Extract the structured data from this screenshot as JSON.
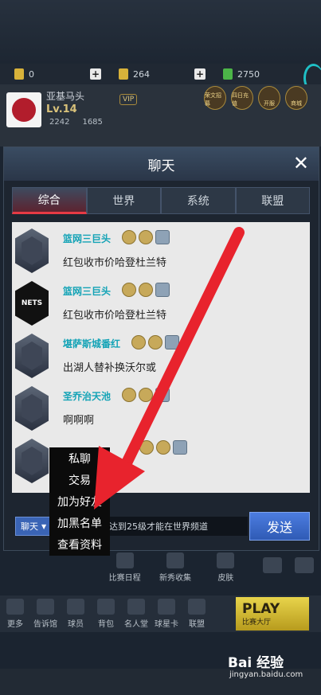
{
  "resources": [
    {
      "icon": "coin-icon",
      "value": "0"
    },
    {
      "icon": "gold-icon",
      "value": "264"
    },
    {
      "icon": "cash-icon",
      "value": "2750"
    }
  ],
  "profile": {
    "name": "亚基马头",
    "level": "Lv.14",
    "vip": "VIP",
    "stat1": "2242",
    "stat2": "1685"
  },
  "top_icons": [
    "荣文招募",
    "四日充值",
    "开服",
    "商城"
  ],
  "chat": {
    "title": "聊天",
    "close": "✕",
    "tabs": [
      "综合",
      "世界",
      "系统",
      "联盟"
    ],
    "active_tab": "综合",
    "messages": [
      {
        "user": "篮网三巨头",
        "text": "红包收市价哈登杜兰特",
        "badge": "shield"
      },
      {
        "user": "篮网三巨头",
        "text": "红包收市价哈登杜兰特",
        "badge": "NETS"
      },
      {
        "user": "堪萨斯城番红",
        "text": "出湖人替补换沃尔或",
        "badge": "shield"
      },
      {
        "user": "圣乔治天池",
        "text": "啊啊啊",
        "badge": "shield"
      },
      {
        "user": "",
        "text": "",
        "badge": "shield"
      }
    ],
    "channel": "聊天",
    "input_hint": "达到25级才能在世界频道",
    "send": "发送"
  },
  "context_menu": [
    "私聊",
    "交易",
    "加为好友",
    "加黑名单",
    "查看资料"
  ],
  "nav2": [
    "比赛日程",
    "新秀收集",
    "皮肤"
  ],
  "nav": [
    "更多",
    "告诉馆",
    "球员",
    "背包",
    "名人堂",
    "球星卡",
    "联盟"
  ],
  "play": {
    "big": "PLAY",
    "small": "比赛大厅"
  },
  "watermark": {
    "logo": "Bai 经验",
    "url": "jingyan.baidu.com"
  },
  "colors": {
    "accent": "#e63a44",
    "username": "#13a3b6",
    "send": "#3a64b5",
    "arrow": "#e8232d"
  }
}
